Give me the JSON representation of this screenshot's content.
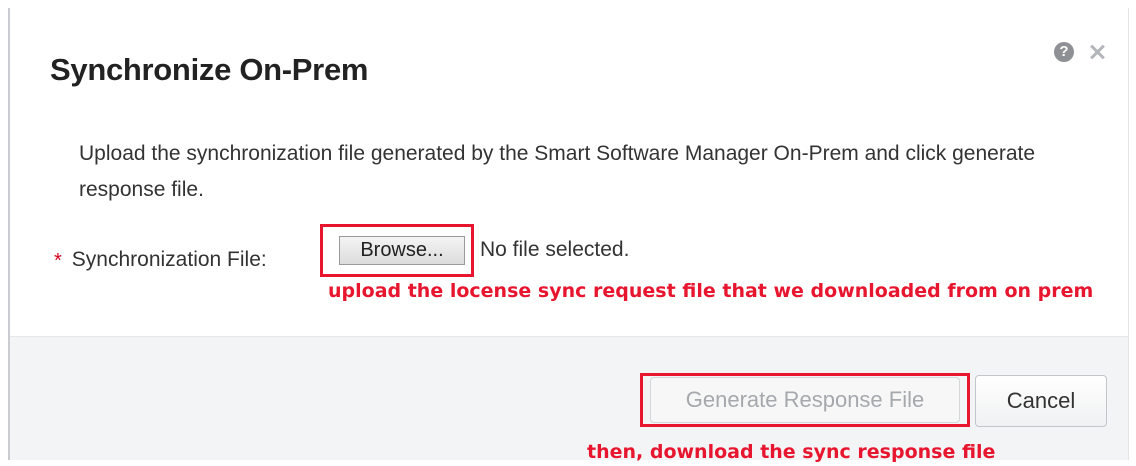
{
  "dialog": {
    "title": "Synchronize On-Prem",
    "help_icon_glyph": "?",
    "description": "Upload the synchronization file generated by the Smart Software Manager On-Prem and click generate response file."
  },
  "form": {
    "required_marker": "*",
    "file_label": "Synchronization File:",
    "browse_label": "Browse...",
    "file_status": "No file selected."
  },
  "annotations": {
    "upload_note": "upload the locense sync request file that we downloaded from on prem",
    "download_note": "then, download the sync response file",
    "highlight_color": "#e8152f"
  },
  "footer": {
    "generate_label": "Generate Response File",
    "cancel_label": "Cancel"
  },
  "icons": {
    "help": "help-icon",
    "close": "close-icon"
  }
}
